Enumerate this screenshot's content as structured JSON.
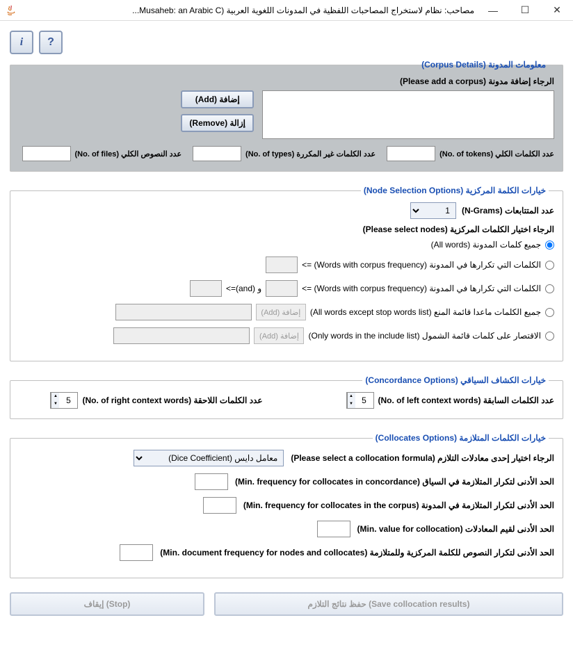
{
  "window": {
    "title": "مصاحب: نظام لاستخراج المصاحبات اللفظية في المدونات اللغوية العربية (Musaheb: an Arabic C..."
  },
  "toolbar": {
    "info": "i",
    "help": "?"
  },
  "corpus": {
    "legend": "معلومات المدونة (Corpus Details)",
    "please_add": "الرجاء إضافة مدونة (Please add a corpus)",
    "add": "إضافة (Add)",
    "remove": "إزالة (Remove)",
    "tokens_label": "عدد الكلمات الكلي (No. of tokens)",
    "types_label": "عدد الكلمات غير المكررة (No. of types)",
    "files_label": "عدد النصوص الكلي (No. of files)"
  },
  "node": {
    "legend": "خيارات الكلمة المركزية (Node Selection Options)",
    "ngrams_label": "عدد المتتابعات (N-Grams)",
    "ngrams_value": "1",
    "please_select": "الرجاء اختيار الكلمات المركزية (Please select nodes)",
    "opt_all": "جميع كلمات المدونة (All words)",
    "opt_freq1": "الكلمات التي تكرارها في المدونة (Words with corpus frequency) =>",
    "opt_freq2_a": "الكلمات التي تكرارها في المدونة (Words with corpus frequency) =>",
    "opt_freq2_and": "و (and)=>",
    "opt_stop": "جميع الكلمات ماعدا قائمة المنع (All words except stop words list)",
    "opt_include": "الاقتصار على كلمات قائمة الشمول (Only words in the include list)",
    "add_btn": "إضافة (Add)"
  },
  "conc": {
    "legend": "خيارات الكشاف السياقي (Concordance Options)",
    "left_label": "عدد الكلمات السابقة (No. of left context words)",
    "left_value": "5",
    "right_label": "عدد الكلمات اللاحقة (No. of right context words)",
    "right_value": "5"
  },
  "coll": {
    "legend": "خيارات الكلمات المتلازمة (Collocates Options)",
    "formula_label": "الرجاء اختيار إحدى معادلات التلازم (Please select a collocation formula)",
    "formula_value": "معامل دايس (Dice Coefficient)",
    "min_conc": "الحد الأدنى لتكرار المتلازمة في السياق (Min. frequency for collocates in concordance)",
    "min_corpus": "الحد الأدنى لتكرار المتلازمة في المدونة (Min. frequency for collocates in the corpus)",
    "min_value": "الحد الأدنى لقيم المعادلات (Min. value for collocation)",
    "min_doc": "الحد الأدنى لتكرار النصوص للكلمة المركزية  وللمتلازمة (Min. document frequency for nodes and collocates)"
  },
  "bottom": {
    "save": "حفظ نتائج التلازم (Save collocation results)",
    "stop": "إيقاف (Stop)"
  }
}
